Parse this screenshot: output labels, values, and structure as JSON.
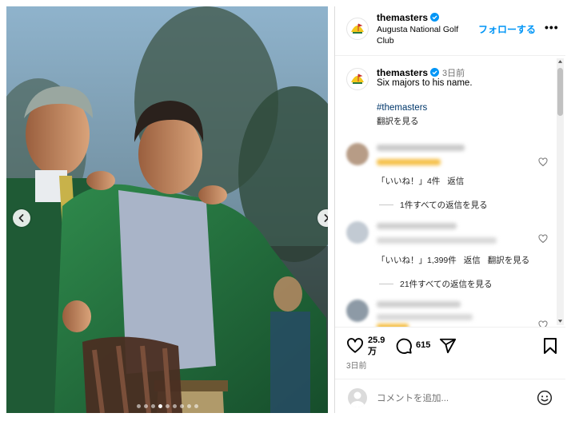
{
  "header": {
    "username": "themasters",
    "subtitle": "Augusta National Golf Club",
    "follow_label": "フォローする",
    "more_label": "•••"
  },
  "caption": {
    "username": "themasters",
    "time_ago": "3日前",
    "text": "Six majors to his name.",
    "hashtag": "#themasters",
    "translate_label": "翻訳を見る"
  },
  "comments": [
    {
      "likes_label": "「いいね！」4件",
      "reply_label": "返信",
      "view_replies_label": "1件すべての返信を見る"
    },
    {
      "likes_label": "「いいね！」1,399件",
      "reply_label": "返信",
      "translate_label": "翻訳を見る",
      "view_replies_label": "21件すべての返信を見る"
    },
    {}
  ],
  "actions": {
    "likes_count": "25.9万",
    "comments_count": "615",
    "post_time": "3日前"
  },
  "add_comment": {
    "placeholder": "コメントを追加..."
  },
  "carousel": {
    "slide_count": 9,
    "active_index": 3
  },
  "colors": {
    "accent": "#0095f6",
    "masters_green": "#1e6b3d",
    "verified": "#0095f6"
  },
  "icons": [
    "chevron-left-icon",
    "chevron-right-icon",
    "heart-icon",
    "comment-icon",
    "share-icon",
    "bookmark-icon",
    "emoji-icon",
    "verified-icon",
    "masters-logo"
  ]
}
